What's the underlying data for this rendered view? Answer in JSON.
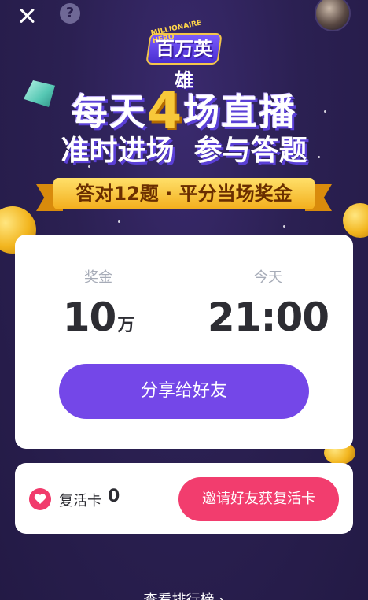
{
  "header": {
    "logo_sub": "MILLIONAIRE HERO",
    "logo_title": "百万英雄"
  },
  "headline": {
    "line1_pre": "每天",
    "line1_num": "4",
    "line1_post": "场直播",
    "line2": "准时进场  参与答题",
    "ribbon": "答对12题 · 平分当场奖金"
  },
  "stats": {
    "prize_label": "奖金",
    "prize_value": "10",
    "prize_unit": "万",
    "time_label": "今天",
    "time_value": "21:00"
  },
  "share_button": "分享给好友",
  "revive": {
    "label": "复活卡",
    "count": "0",
    "invite_button": "邀请好友获复活卡"
  },
  "ranking_link": "查看排行榜 ›",
  "colors": {
    "background": "#2a1f4e",
    "share_button": "#7447e8",
    "invite_button": "#f23d6e",
    "heart": "#f13b6c",
    "ribbon": "#f3ae1c"
  }
}
